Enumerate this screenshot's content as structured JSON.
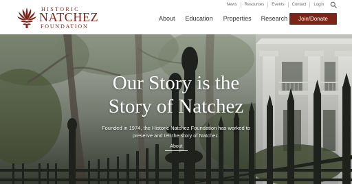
{
  "logo": {
    "line1": "HISTORIC",
    "line2": "NATCHEZ",
    "line3": "FOUNDATION"
  },
  "utility_nav": {
    "items": [
      "News",
      "Resources",
      "Events",
      "Contact",
      "Login"
    ],
    "search_icon": "search-icon"
  },
  "main_nav": {
    "items": [
      "About",
      "Education",
      "Properties",
      "Research"
    ]
  },
  "donate": {
    "label": "Join/Donate"
  },
  "hero": {
    "title_line1": "Our Story is the",
    "title_line2": "Story of Natchez",
    "subtitle_line1": "Founded in 1974, the Historic Natchez Foundation has worked to",
    "subtitle_line2": "preserve and tell the story of Natchez.",
    "link_label": "About"
  },
  "colors": {
    "brand": "#7b2518",
    "nav_text": "#333333",
    "utility_text": "#666666",
    "hero_text": "#ffffff"
  }
}
